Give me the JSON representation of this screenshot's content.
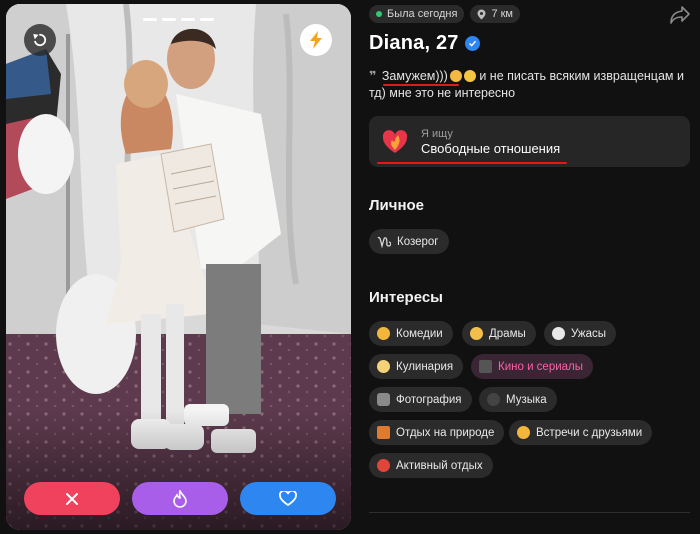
{
  "card": {
    "photo_alt": "wedding photo",
    "actions": {
      "dislike": "close-icon",
      "super_like": "flame-icon",
      "like": "heart-icon"
    }
  },
  "profile": {
    "status": "Была сегодня",
    "distance": "7 км",
    "name": "Diana, 27",
    "bio_before": "",
    "bio_emphasis": "Замужем)))",
    "bio_after": " и не писать всяким извращенцам и тд) мне это не интересно",
    "looking_label": "Я ищу",
    "looking_value": "Свободные отношения"
  },
  "sections": {
    "personal_title": "Личное",
    "interests_title": "Интересы"
  },
  "personal_tags": [
    {
      "label": "Козерог",
      "icon": "capricorn-icon"
    }
  ],
  "interests": [
    {
      "label": "Комедии",
      "icon": "grinning-face-icon",
      "color": "#f2b63c"
    },
    {
      "label": "Драмы",
      "icon": "pleading-face-icon",
      "color": "#f2c04a"
    },
    {
      "label": "Ужасы",
      "icon": "ghost-icon",
      "color": "#e8e8e8"
    },
    {
      "label": "Кулинария",
      "icon": "chef-icon",
      "color": "#f4d27a"
    },
    {
      "label": "Кино и сериалы",
      "icon": "clapperboard-icon",
      "color": "#555555",
      "highlight": true
    },
    {
      "label": "Фотография",
      "icon": "camera-icon",
      "color": "#8a8a8a"
    },
    {
      "label": "Музыка",
      "icon": "music-notes-icon",
      "color": "#444444"
    },
    {
      "label": "Отдых на природе",
      "icon": "camping-icon",
      "color": "#e07a2f"
    },
    {
      "label": "Встречи с друзьями",
      "icon": "handshake-icon",
      "color": "#f2b63c"
    },
    {
      "label": "Активный отдых",
      "icon": "target-icon",
      "color": "#e0453a"
    }
  ],
  "colors": {
    "accent_red": "#e21919",
    "dislike": "#f0425d",
    "super_like": "#a85ee8",
    "like": "#2e86f0",
    "online": "#2ecc71",
    "highlight_pink": "#ff5fa6"
  }
}
